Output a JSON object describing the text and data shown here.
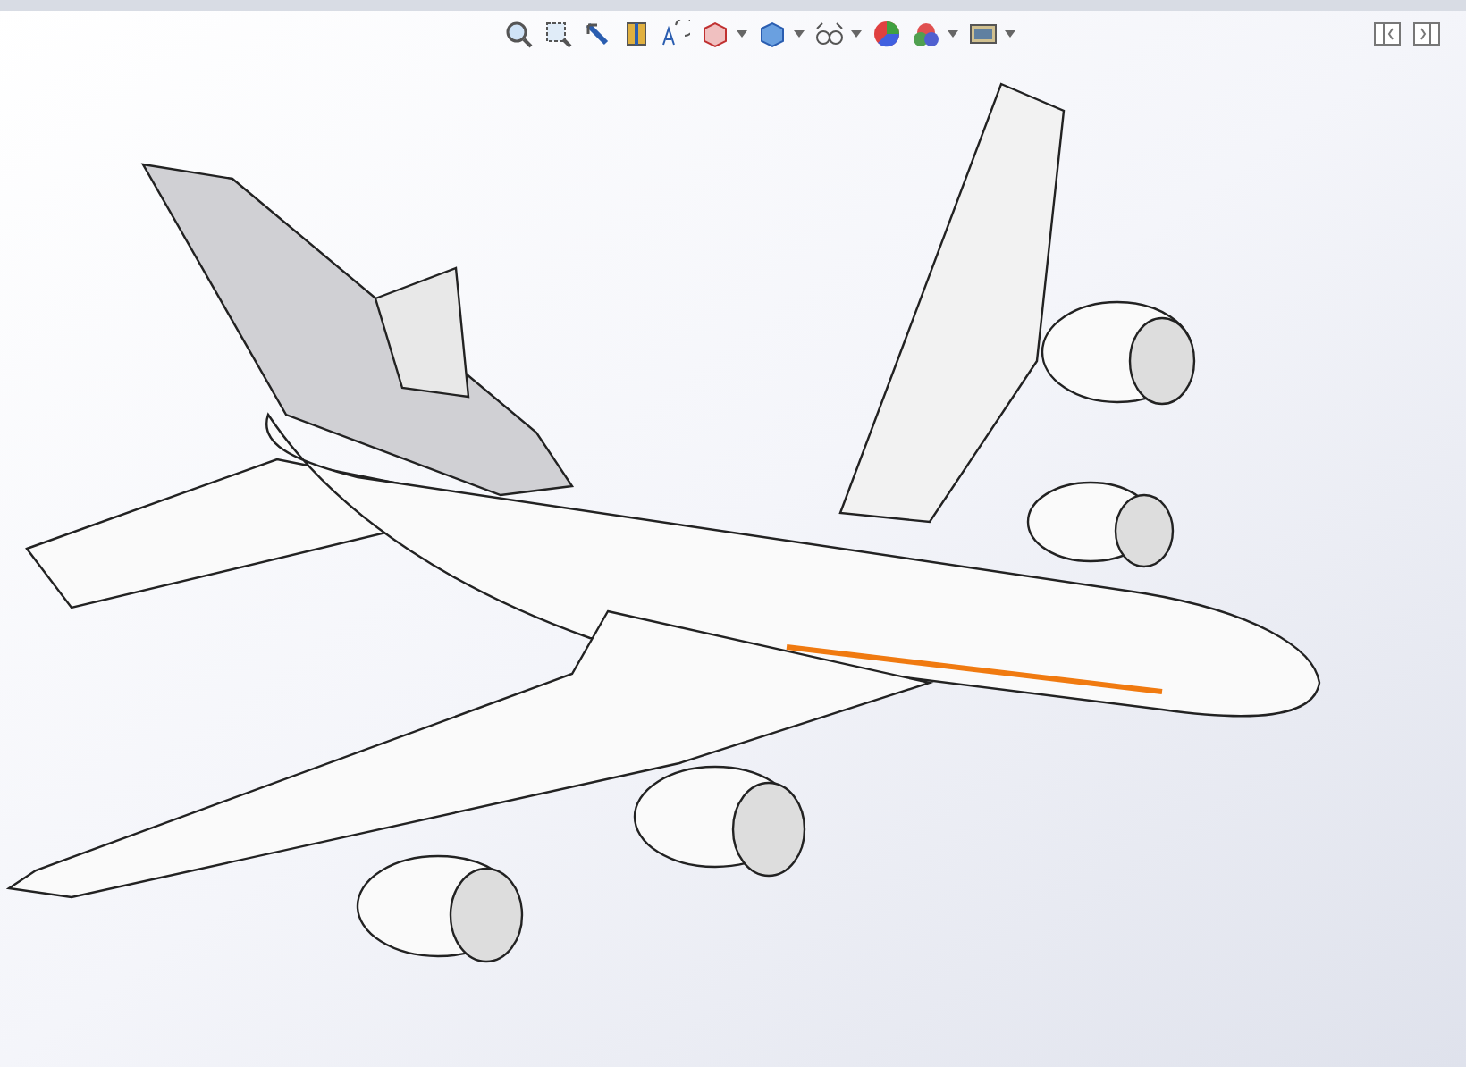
{
  "view_toolbar": [
    {
      "kind": "zoom-fit",
      "dropdown": false
    },
    {
      "kind": "zoom-area",
      "dropdown": false
    },
    {
      "kind": "previous-view",
      "dropdown": false
    },
    {
      "kind": "section-view",
      "dropdown": false
    },
    {
      "kind": "dynamic-annotation",
      "dropdown": false
    },
    {
      "kind": "view-orientation",
      "dropdown": true
    },
    {
      "kind": "display-style",
      "dropdown": true
    },
    {
      "kind": "hide-show",
      "dropdown": true
    },
    {
      "kind": "edit-appearance",
      "dropdown": false
    },
    {
      "kind": "apply-scene",
      "dropdown": true
    },
    {
      "kind": "view-settings",
      "dropdown": true
    }
  ],
  "window_controls": [
    {
      "kind": "split-left"
    },
    {
      "kind": "split-right"
    }
  ]
}
